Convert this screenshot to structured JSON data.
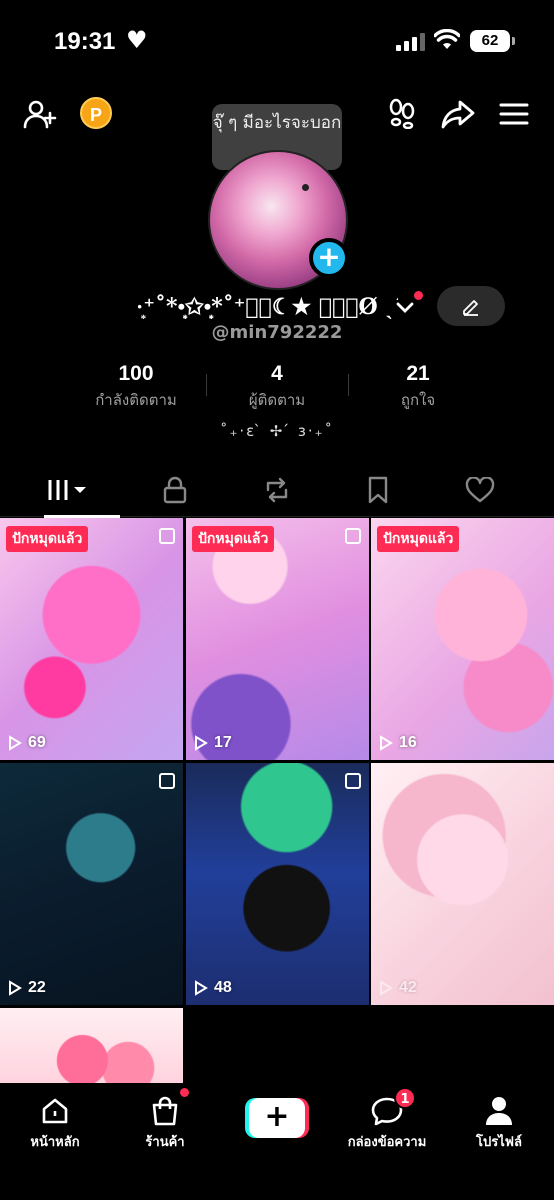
{
  "status_bar": {
    "time": "19:31",
    "heart": "♥",
    "battery": "62"
  },
  "top_bar": {
    "coin_label": "P"
  },
  "tooltip": {
    "text": "จุ๊ ๆ มีอะไรจะบอก"
  },
  "profile": {
    "display_name": "·͙⁺˚*•̩̩͙✩•̩̩͙*˚⁺‧͙☾★ 𝑴𝒊𝒏Ø ˎˊ˗🌷✨·͙⁺˚…",
    "username": "@min792222",
    "bio": "˚₊·ɛ ̀ ✢ ́ ɜ·₊˚"
  },
  "stats": [
    {
      "value": "100",
      "label": "กำลังติดตาม"
    },
    {
      "value": "4",
      "label": "ผู้ติดตาม"
    },
    {
      "value": "21",
      "label": "ถูกใจ"
    }
  ],
  "tabs": [
    "videos-tab",
    "private-tab",
    "reposts-tab",
    "favorites-tab",
    "liked-tab"
  ],
  "grid": [
    {
      "pinned": "ปักหมุดแล้ว",
      "views": "69",
      "multi": true
    },
    {
      "pinned": "ปักหมุดแล้ว",
      "views": "17",
      "multi": true
    },
    {
      "pinned": "ปักหมุดแล้ว",
      "views": "16",
      "multi": false
    },
    {
      "pinned": "",
      "views": "22",
      "multi": true
    },
    {
      "pinned": "",
      "views": "48",
      "multi": true
    },
    {
      "pinned": "",
      "views": "42",
      "multi": false
    },
    {
      "pinned": "",
      "views": "",
      "multi": false
    }
  ],
  "nav": {
    "home": "หน้าหลัก",
    "shop": "ร้านค้า",
    "create": "+",
    "inbox": "กล่องข้อความ",
    "inbox_badge": "1",
    "profile": "โปรไฟล์"
  },
  "colors": {
    "accent_red": "#fe2c55",
    "accent_cyan": "#25f4ee",
    "plus_blue": "#22b8ee",
    "coin": "#f7a416"
  }
}
